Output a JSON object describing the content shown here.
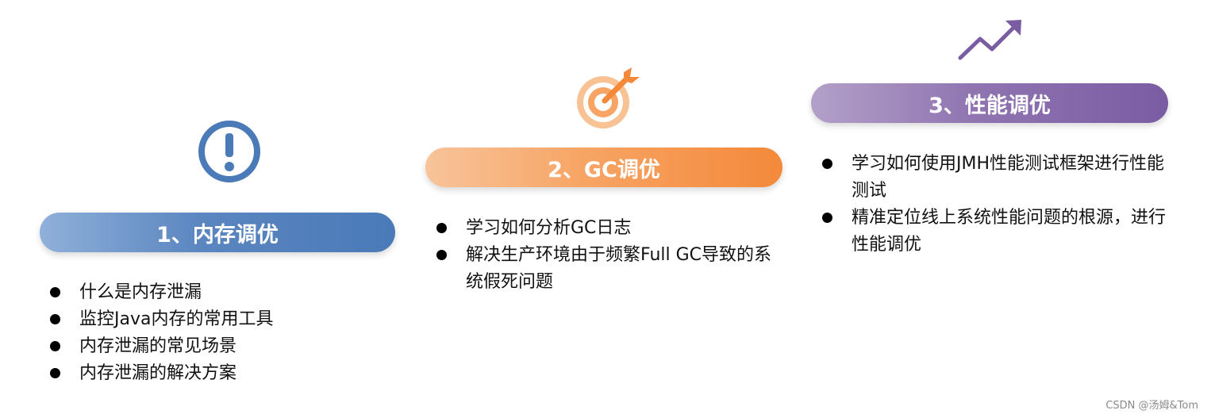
{
  "sections": [
    {
      "title": "1、内存调优",
      "icon": "exclamation-circle-icon",
      "color": "#4a7ab8",
      "items": [
        "什么是内存泄漏",
        "监控Java内存的常用工具",
        "内存泄漏的常见场景",
        "内存泄漏的解决方案"
      ]
    },
    {
      "title": "2、GC调优",
      "icon": "target-dart-icon",
      "color": "#f4893a",
      "items": [
        "学习如何分析GC日志",
        "解决生产环境由于频繁Full GC导致的系统假死问题"
      ]
    },
    {
      "title": "3、性能调优",
      "icon": "trend-up-arrow-icon",
      "color": "#7a5ca3",
      "items": [
        "学习如何使用JMH性能测试框架进行性能测试",
        "精准定位线上系统性能问题的根源，进行性能调优"
      ]
    }
  ],
  "watermark": "CSDN @汤姆&Tom"
}
